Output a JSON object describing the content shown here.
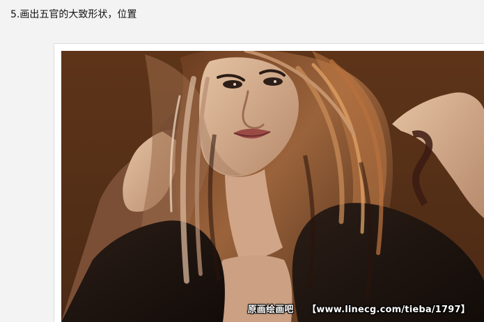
{
  "step": {
    "title": "5.画出五官的大致形状，位置"
  },
  "image": {
    "watermark_site": "原画绘画吧",
    "watermark_url": "【www.linecg.com/tieba/1797】"
  },
  "colors": {
    "background": "#5b3318",
    "hair": "#8a5a35",
    "skin": "#d7b08f",
    "shadow": "#1c120d"
  }
}
